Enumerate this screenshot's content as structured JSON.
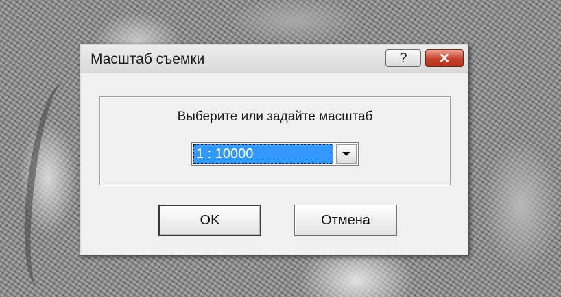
{
  "dialog": {
    "title": "Масштаб съемки",
    "help_glyph": "?",
    "close_glyph": "✕"
  },
  "scale": {
    "prompt": "Выберите или задайте масштаб",
    "selected": "1 : 10000"
  },
  "buttons": {
    "ok_label": "OK",
    "cancel_label": "Отмена"
  },
  "colors": {
    "selection": "#3399ff",
    "close_button": "#c4412c"
  }
}
